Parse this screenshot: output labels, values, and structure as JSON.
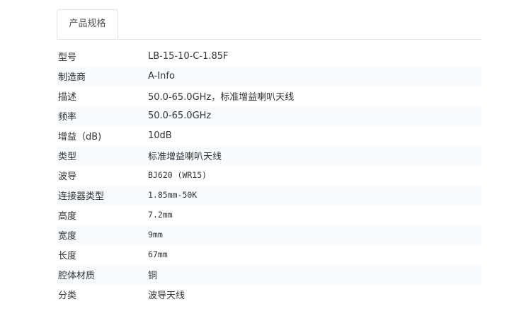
{
  "tabs": [
    {
      "label": "产品规格"
    }
  ],
  "specs": [
    {
      "label": "型号",
      "value": "LB-15-10-C-1.85F"
    },
    {
      "label": "制造商",
      "value": "A-Info"
    },
    {
      "label": "描述",
      "value": "50.0-65.0GHz，标准增益喇叭天线"
    },
    {
      "label": "频率",
      "value": "50.0-65.0GHz"
    },
    {
      "label": "增益（dB)",
      "value": "10dB"
    },
    {
      "label": "类型",
      "value": "标准增益喇叭天线"
    },
    {
      "label": "波导",
      "value": "BJ620 (WR15)"
    },
    {
      "label": "连接器类型",
      "value": "1.85mm-50K"
    },
    {
      "label": "高度",
      "value": "7.2mm"
    },
    {
      "label": "宽度",
      "value": "9mm"
    },
    {
      "label": "长度",
      "value": "67mm"
    },
    {
      "label": "腔体材质",
      "value": "铜"
    },
    {
      "label": "分类",
      "value": "波导天线"
    }
  ]
}
